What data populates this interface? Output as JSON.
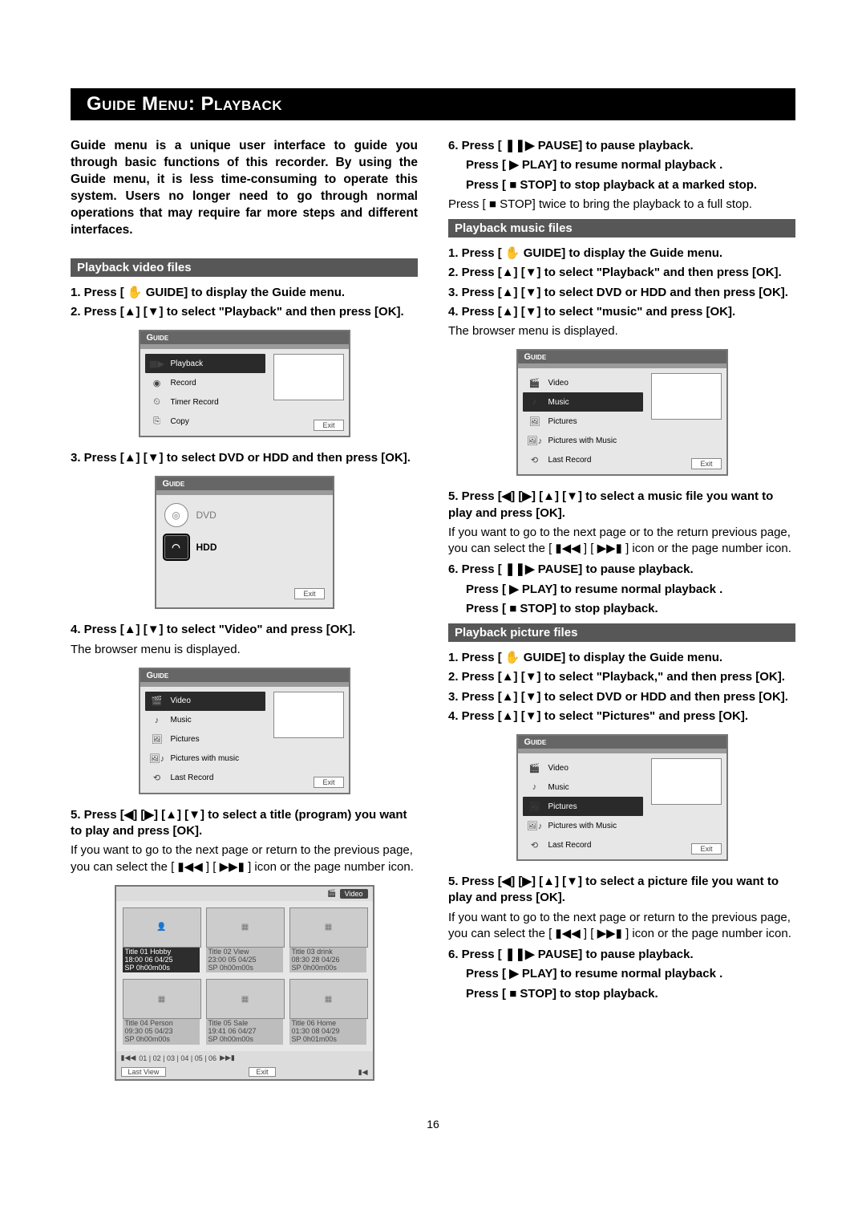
{
  "page": {
    "title": "Guide Menu: Playback",
    "intro": "Guide menu is a unique user interface to guide you through basic functions of this recorder. By using the Guide menu, it is less time-consuming to operate this system. Users no longer need to go through normal operations that may require far more steps and different interfaces.",
    "page_number": "16"
  },
  "glyphs": {
    "up": "▲",
    "down": "▼",
    "left": "◀",
    "right": "▶",
    "prev": "▮◀◀",
    "next": "▶▶▮",
    "play": "▶",
    "pause": "❚❚▶",
    "stop": "■",
    "guide": "✋"
  },
  "sections": {
    "video": {
      "heading": "Playback video files",
      "s1": "1. Press [ ✋ GUIDE] to display the Guide menu.",
      "s2": "2. Press [▲]  [▼] to select \"Playback\" and then press [OK].",
      "s3": "3. Press [▲]  [▼] to select DVD or HDD and then press [OK].",
      "s4": "4. Press [▲]  [▼] to select \"Video\" and press [OK].",
      "s4_note": "The browser menu is displayed.",
      "s5": "5. Press [◀]  [▶] [▲]  [▼] to select a title (program) you want to play and press [OK].",
      "s5_note": "If you want to go to the next page or return to the previous page, you can select the [ ▮◀◀ ] [ ▶▶▮ ] icon or the page number icon.",
      "s6a": "6. Press [ ❚❚▶ PAUSE] to pause playback.",
      "s6b": "Press [ ▶ PLAY] to resume normal playback .",
      "s6c": "Press [ ■ STOP] to stop playback at a marked stop.",
      "s6d": "Press [ ■ STOP] twice to bring the playback to a full stop."
    },
    "music": {
      "heading": "Playback music files",
      "s1": "1. Press [ ✋ GUIDE] to display the Guide menu.",
      "s2": "2. Press [▲]  [▼] to select \"Playback\" and then press [OK].",
      "s3": "3. Press [▲]  [▼] to select  DVD or HDD and then press [OK].",
      "s4": "4. Press [▲]  [▼] to select \"music\" and press [OK].",
      "s4_note": "The browser menu is displayed.",
      "s5": "5. Press [◀]  [▶] [▲]  [▼] to select a music file you want to play and press [OK].",
      "s5_note": "If you want to go to the next page or to the return previous page, you can select the [ ▮◀◀ ] [ ▶▶▮ ] icon or the page number icon.",
      "s6a": "6. Press [ ❚❚▶ PAUSE] to pause playback.",
      "s6b": "Press [ ▶ PLAY] to resume normal playback .",
      "s6c": "Press [ ■ STOP] to stop playback."
    },
    "picture": {
      "heading": "Playback picture files",
      "s1": "1. Press [ ✋ GUIDE] to display the Guide menu.",
      "s2": "2. Press [▲]  [▼] to select \"Playback,\" and then press [OK].",
      "s3": "3. Press [▲]  [▼] to select  DVD or HDD and then press [OK].",
      "s4": "4. Press [▲]  [▼] to select \"Pictures\" and press [OK].",
      "s5": "5. Press [◀]  [▶] [▲]  [▼] to select a picture file you want to play and press [OK].",
      "s5_note": "If you want to go to the next page or return to the previous page, you can select the [ ▮◀◀ ] [ ▶▶▮ ] icon or the page number icon.",
      "s6a": "6. Press [ ❚❚▶ PAUSE] to pause playback.",
      "s6b": "Press [ ▶ PLAY] to resume normal playback .",
      "s6c": "Press [ ■ STOP] to stop playback."
    }
  },
  "figures": {
    "guide_head": "Guide",
    "exit": "Exit",
    "fig_a": {
      "items": [
        "Playback",
        "Record",
        "Timer Record",
        "Copy"
      ],
      "selected": 0
    },
    "fig_b": {
      "dvd": "DVD",
      "hdd": "HDD",
      "selected": 1
    },
    "fig_c": {
      "items": [
        "Video",
        "Music",
        "Pictures",
        "Pictures with music",
        "Last Record"
      ],
      "selected": 0
    },
    "fig_music": {
      "items": [
        "Video",
        "Music",
        "Pictures",
        "Pictures with Music",
        "Last Record"
      ],
      "selected": 1
    },
    "fig_pics": {
      "items": [
        "Video",
        "Music",
        "Pictures",
        "Pictures with Music",
        "Last Record"
      ],
      "selected": 2
    },
    "fig_thumbs": {
      "top_label": "Video",
      "thumbs": [
        {
          "t": "Title 01 Hobby",
          "d": "18:00 06 04/25",
          "q": "SP 0h00m00s"
        },
        {
          "t": "Title 02 View",
          "d": "23:00 05 04/25",
          "q": "SP 0h00m00s"
        },
        {
          "t": "Title 03 drink",
          "d": "08:30 28 04/26",
          "q": "SP 0h00m00s"
        },
        {
          "t": "Title 04 Person",
          "d": "09:30 05 04/23",
          "q": "SP 0h00m00s"
        },
        {
          "t": "Title 05 Sale",
          "d": "19:41 06 04/27",
          "q": "SP 0h00m00s"
        },
        {
          "t": "Title 06 Home",
          "d": "01:30 08 04/29",
          "q": "SP 0h01m00s"
        }
      ],
      "last_view": "Last View",
      "pages": "01 | 02 | 03 | 04 | 05 | 06"
    }
  }
}
